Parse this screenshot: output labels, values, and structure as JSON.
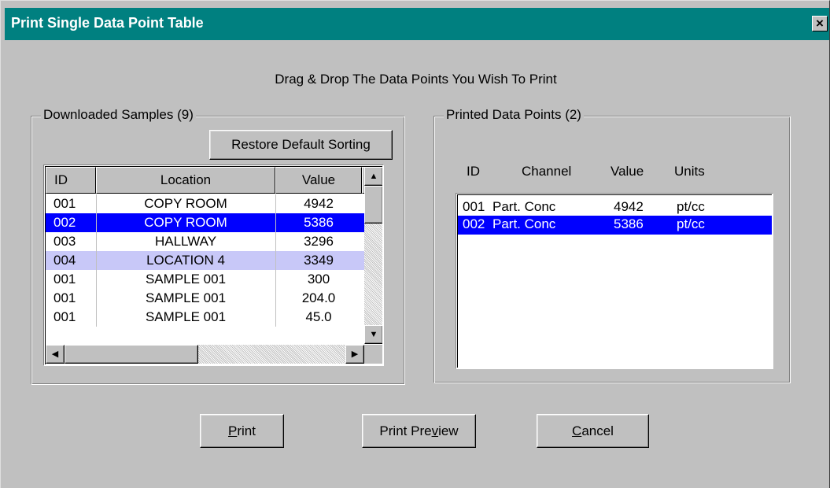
{
  "window": {
    "title": "Print Single Data Point Table",
    "close_glyph": "×"
  },
  "instruction": "Drag & Drop The Data Points You Wish To Print",
  "downloaded": {
    "legend": "Downloaded Samples (9)",
    "restore_button": "Restore Default Sorting",
    "columns": [
      "ID",
      "Location",
      "Value"
    ],
    "rows": [
      {
        "id": "001",
        "location": "COPY ROOM",
        "value": "4942",
        "state": "normal"
      },
      {
        "id": "002",
        "location": "COPY ROOM",
        "value": "5386",
        "state": "selected"
      },
      {
        "id": "003",
        "location": "HALLWAY",
        "value": "3296",
        "state": "normal"
      },
      {
        "id": "004",
        "location": "LOCATION 4",
        "value": "3349",
        "state": "highlight"
      },
      {
        "id": "001",
        "location": "SAMPLE 001",
        "value": "300",
        "state": "normal"
      },
      {
        "id": "001",
        "location": "SAMPLE 001",
        "value": "204.0",
        "state": "normal"
      },
      {
        "id": "001",
        "location": "SAMPLE 001",
        "value": "45.0",
        "state": "normal"
      }
    ]
  },
  "printed": {
    "legend": "Printed Data Points (2)",
    "columns": [
      "ID",
      "Channel",
      "Value",
      "Units"
    ],
    "rows": [
      {
        "id": "001",
        "channel": "Part. Conc",
        "value": "4942",
        "units": "pt/cc",
        "state": "normal"
      },
      {
        "id": "002",
        "channel": "Part. Conc",
        "value": "5386",
        "units": "pt/cc",
        "state": "selected"
      }
    ]
  },
  "buttons": {
    "print_pre": "",
    "print_mnemonic": "P",
    "print_post": "rint",
    "preview_pre": "Print Pre",
    "preview_mnemonic": "v",
    "preview_post": "iew",
    "cancel_pre": "",
    "cancel_mnemonic": "C",
    "cancel_post": "ancel"
  },
  "colors": {
    "titlebar": "#008080",
    "selection": "#0000ff",
    "highlight": "#c8c8f8",
    "face": "#c0c0c0"
  }
}
